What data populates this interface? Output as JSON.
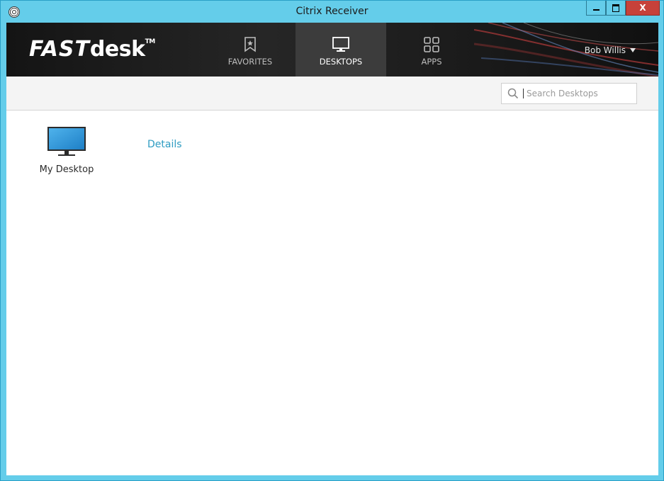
{
  "window": {
    "title": "Citrix Receiver",
    "close_label": "X"
  },
  "brand": {
    "logo_fast": "FAST",
    "logo_desk": "desk",
    "logo_tm": "TM"
  },
  "nav": {
    "tabs": [
      {
        "label": "FAVORITES",
        "icon": "bookmark-icon",
        "active": false
      },
      {
        "label": "DESKTOPS",
        "icon": "monitor-icon",
        "active": true
      },
      {
        "label": "APPS",
        "icon": "grid-icon",
        "active": false
      }
    ]
  },
  "user": {
    "name": "Bob Willis"
  },
  "search": {
    "placeholder": "Search Desktops",
    "value": ""
  },
  "desktops": [
    {
      "name": "My Desktop",
      "icon": "monitor-icon",
      "details_label": "Details"
    }
  ],
  "colors": {
    "window_frame": "#64cdea",
    "header_bg": "#1e1e1e",
    "active_tab_bg": "#3c3c3c",
    "link": "#2e9cc2",
    "close_button": "#c7413a"
  }
}
